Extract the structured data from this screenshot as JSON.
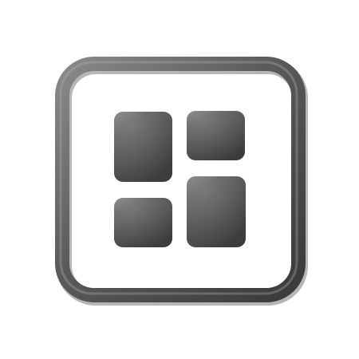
{
  "icon": {
    "name": "dashboard-layout-icon",
    "style": "3d",
    "colors": {
      "background": "#ffffff",
      "frame": "#5a5a5a",
      "frame_highlight": "#8a8a8a",
      "frame_shadow": "#3a3a3a",
      "tile": "#545454",
      "tile_highlight": "#7e7e7e",
      "tile_shadow": "#3c3c3c"
    }
  }
}
